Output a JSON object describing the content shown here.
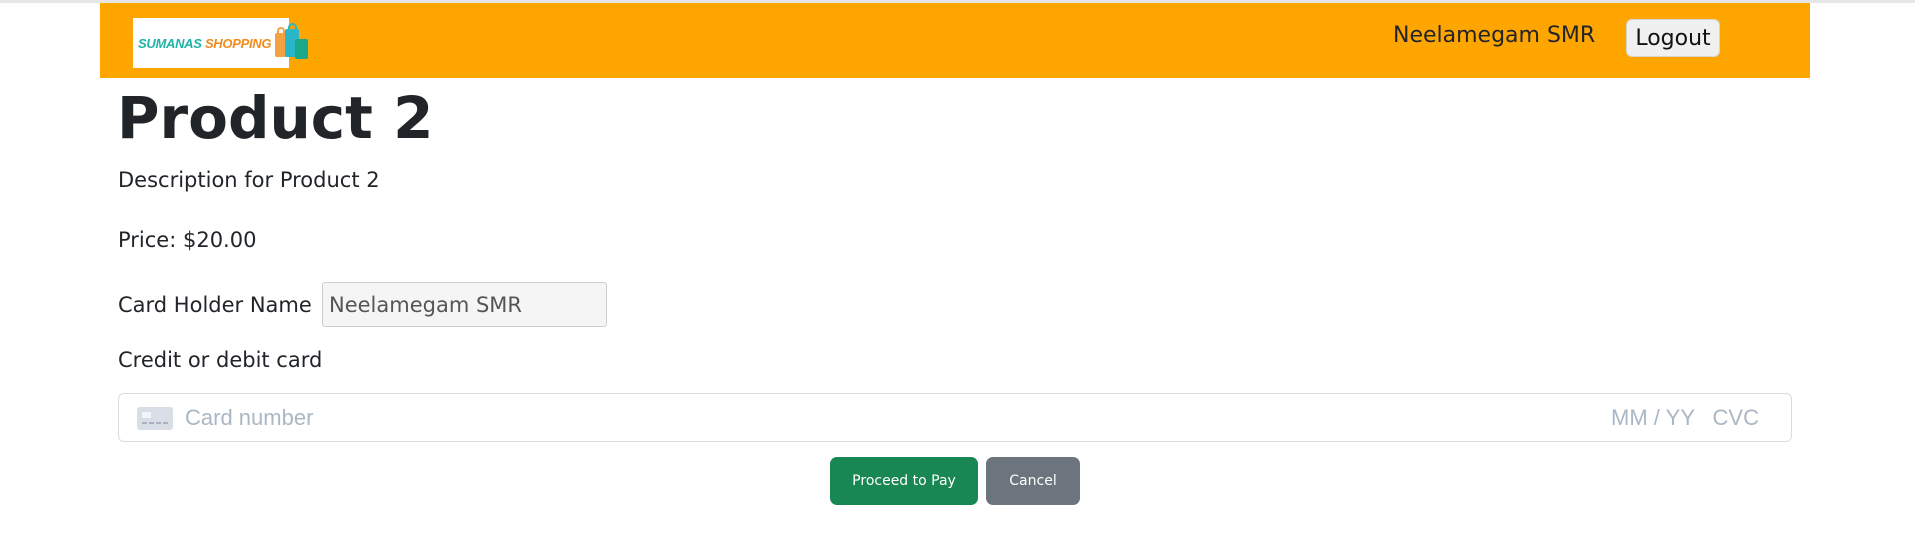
{
  "navbar": {
    "logo_text_part1": "SUMANAS",
    "logo_text_part2": "SHOPPING",
    "logo_icon": "shopping-bags-icon",
    "user_name": "Neelamegam SMR",
    "logout_label": "Logout",
    "background_color": "#ffa500"
  },
  "product": {
    "title": "Product 2",
    "description": "Description for Product 2",
    "price_text": "Price: $20.00"
  },
  "payment_form": {
    "card_holder_label": "Card Holder Name",
    "card_holder_value": "Neelamegam SMR",
    "card_label": "Credit or debit card",
    "card_icon": "credit-card-icon",
    "card_number_placeholder": "Card number",
    "expiry_placeholder": "MM / YY",
    "cvc_placeholder": "CVC"
  },
  "actions": {
    "pay_label": "Proceed to Pay",
    "cancel_label": "Cancel",
    "pay_color": "#198754",
    "cancel_color": "#6c757d"
  }
}
